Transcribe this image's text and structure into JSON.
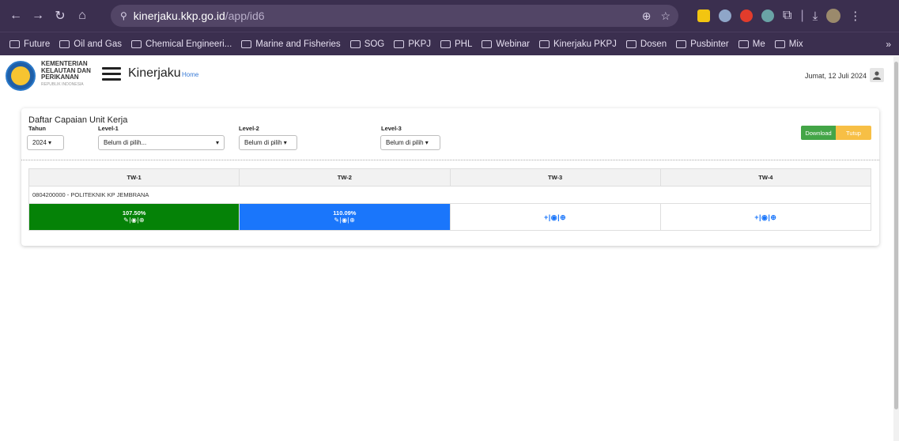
{
  "browser": {
    "url_host": "kinerjaku.kkp.go.id",
    "url_path": "/app/id6",
    "bookmarks": [
      "Future",
      "Oil and Gas",
      "Chemical Engineeri...",
      "Marine and Fisheries",
      "SOG",
      "PKPJ",
      "PHL",
      "Webinar",
      "Kinerjaku PKPJ",
      "Dosen",
      "Pusbinter",
      "Me",
      "Mix"
    ],
    "more": "»"
  },
  "header": {
    "org_line1": "KEMENTERIAN",
    "org_line2": "KELAUTAN DAN",
    "org_line3": "PERIKANAN",
    "org_line4": "REPUBLIK INDONESIA",
    "app_title": "Kinerjaku",
    "home_link": "Home",
    "date": "Jumat, 12 Juli 2024"
  },
  "card": {
    "title": "Daftar Capaian Unit Kerja",
    "filters": {
      "tahun_label": "Tahun",
      "tahun_value": "2024 ▾",
      "level1_label": "Level-1",
      "level1_value": "Belum di pilih...",
      "level2_label": "Level-2",
      "level2_value": "Belum di pilih ▾",
      "level3_label": "Level-3",
      "level3_value": "Belum di pilih ▾"
    },
    "buttons": {
      "download": "Download",
      "tutup": "Tutup"
    },
    "table": {
      "headers": [
        "TW-1",
        "TW-2",
        "TW-3",
        "TW-4"
      ],
      "unit": "0804200000 - POLITEKNIK KP JEMBRANA",
      "tw1_value": "107.50%",
      "tw1_actions": "✎|◉|⊕",
      "tw2_value": "110.09%",
      "tw2_actions": "✎|◉|⊕",
      "tw3_actions": "+|◉|⊕",
      "tw4_actions": "+|◉|⊕"
    }
  },
  "colors": {
    "tw1_bg": "#058207",
    "tw2_bg": "#1a76fb",
    "download": "#43a547",
    "tutup": "#f7bf45"
  }
}
